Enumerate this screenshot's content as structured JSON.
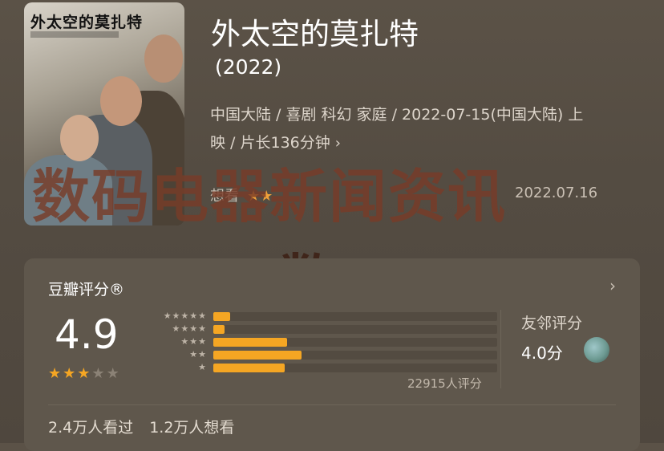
{
  "poster": {
    "title": "外太空的莫扎特"
  },
  "movie": {
    "title": "外太空的莫扎特",
    "year": "(2022)",
    "meta_line1": "中国大陆 / 喜剧 科幻 家庭 / 2022-07-15(中国大陆) 上",
    "meta_line2": "映 / 片长136分钟",
    "chevron": "›"
  },
  "behind_watermark": {
    "label": "想看",
    "date": "2022.07.16"
  },
  "watermark": {
    "line1": "数码电器新闻资讯",
    "line2": ",数"
  },
  "rating": {
    "header": "豆瓣评分®",
    "score": "4.9",
    "stars_filled": 2.5,
    "star_glyph": "★",
    "distribution": [
      {
        "label": "★★★★★",
        "percent": 6
      },
      {
        "label": "★★★★",
        "percent": 4
      },
      {
        "label": "★★★",
        "percent": 26
      },
      {
        "label": "★★",
        "percent": 31
      },
      {
        "label": "★",
        "percent": 25
      }
    ],
    "count": "22915人评分",
    "friend_label": "友邻评分",
    "friend_score": "4.0分",
    "chevron": "›"
  },
  "stats": {
    "watched": "2.4万人看过",
    "wish": "1.2万人想看"
  },
  "colors": {
    "accent": "#f5a623",
    "background": "#544c42",
    "card": "#5f574c"
  }
}
